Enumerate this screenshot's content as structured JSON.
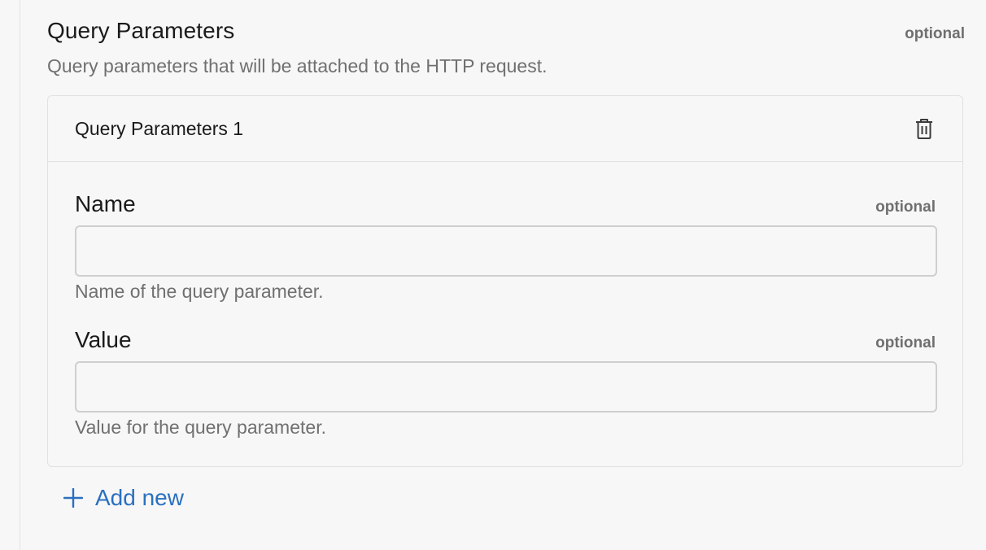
{
  "section": {
    "title": "Query Parameters",
    "optional_label": "optional",
    "description": "Query parameters that will be attached to the HTTP request."
  },
  "card": {
    "title": "Query Parameters 1",
    "delete_icon": "trash-icon",
    "fields": [
      {
        "label": "Name",
        "optional_label": "optional",
        "value": "",
        "placeholder": "",
        "help": "Name of the query parameter."
      },
      {
        "label": "Value",
        "optional_label": "optional",
        "value": "",
        "placeholder": "",
        "help": "Value for the query parameter."
      }
    ]
  },
  "add_new": {
    "label": "Add new",
    "icon": "plus-icon"
  },
  "colors": {
    "accent": "#2a70c0",
    "background": "#f7f7f7",
    "border": "#cfcfcf",
    "muted_text": "#707070"
  }
}
